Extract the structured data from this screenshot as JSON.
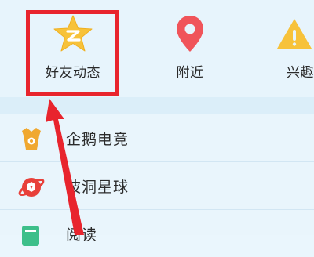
{
  "top_items": [
    {
      "label": "好友动态",
      "icon": "qzone-star-icon"
    },
    {
      "label": "附近",
      "icon": "location-pin-icon"
    },
    {
      "label": "兴趣",
      "icon": "interest-icon"
    }
  ],
  "list_items": [
    {
      "label": "企鹅电竞",
      "icon": "penguin-esports-icon"
    },
    {
      "label": "波洞星球",
      "icon": "bodong-planet-icon"
    },
    {
      "label": "阅读",
      "icon": "reading-icon"
    }
  ],
  "colors": {
    "background": "#eaf6fd",
    "star": "#f7c23a",
    "pin": "#f0545a",
    "highlight": "#e8242d",
    "arrow": "#e8242d",
    "esports": "#f0a830",
    "bodong": "#e8403a",
    "reading": "#3dbf8a"
  }
}
